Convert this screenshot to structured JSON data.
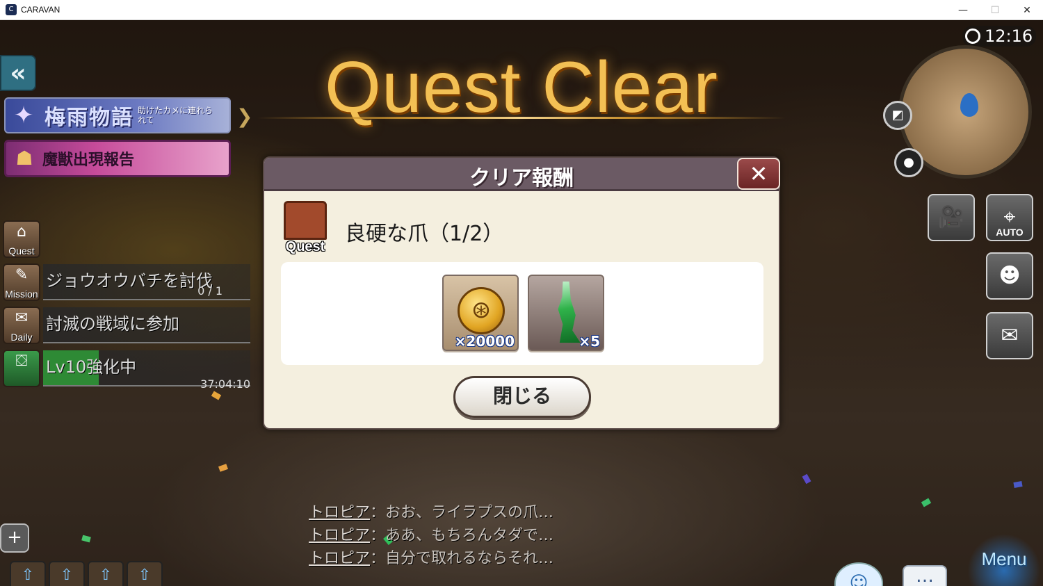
{
  "window": {
    "title": "CARAVAN",
    "controls": [
      "minimize",
      "maximize",
      "close"
    ]
  },
  "banner": {
    "heading": "Quest Clear"
  },
  "left_panel": {
    "event_title": "梅雨物語",
    "event_subtitle": "助けたカメに連れられて",
    "beast_report": "魔獣出現報告",
    "quest_label": "Quest",
    "mission": {
      "label": "Mission",
      "text": "ジョウオウバチを討伐",
      "progress": "0 / 1"
    },
    "daily": {
      "label": "Daily",
      "text": "討滅の戦域に参加"
    },
    "lv_boost": {
      "text": "Lv10強化中",
      "timer": "37:04:10",
      "fill_ratio": 0.27
    }
  },
  "modal": {
    "title": "クリア報酬",
    "quest_badge": "Quest",
    "reward_title": "良硬な爪（1/2）",
    "rewards": [
      {
        "icon": "gold-coin-icon",
        "quantity": "×20000"
      },
      {
        "icon": "claw-item-icon",
        "quantity": "×5"
      }
    ],
    "close_button": "閉じる"
  },
  "hud": {
    "time": "12:16",
    "auto_label": "AUTO",
    "menu_label": "Menu"
  },
  "chat": [
    {
      "speaker": "トロピア",
      "text": "：おお、ライラプスの爪…"
    },
    {
      "speaker": "トロピア",
      "text": "：ああ、もちろんタダで…"
    },
    {
      "speaker": "トロピア",
      "text": "：自分で取れるならそれ…"
    }
  ],
  "colors": {
    "title_gold": "#f3c054",
    "modal_header": "#6b5a64",
    "modal_body": "#f4efdf"
  }
}
